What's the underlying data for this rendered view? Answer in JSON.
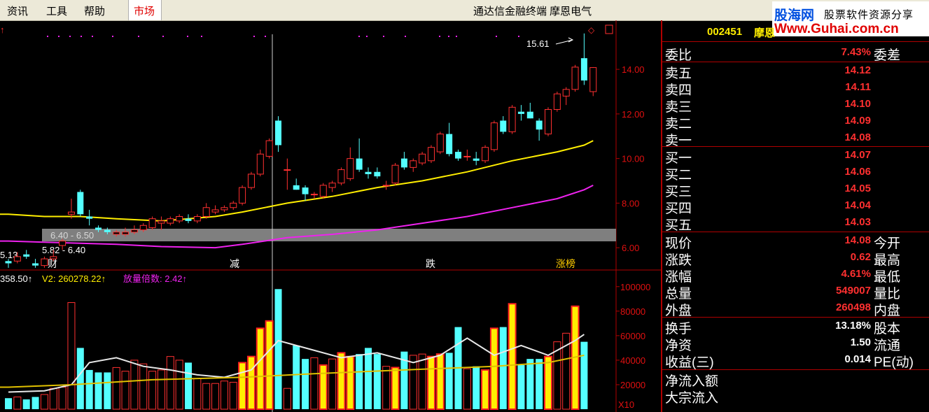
{
  "menu": {
    "items": [
      "资讯",
      "工具",
      "帮助"
    ],
    "market": "市场"
  },
  "window_title": "通达信金融终端  摩恩电气",
  "logo": {
    "brand": "股海网",
    "slogan": "股票软件资源分享",
    "url": "Www.Guhai.com.cn"
  },
  "stock": {
    "code": "002451",
    "name": "摩恩"
  },
  "kline": {
    "price_axis": [
      "14.00",
      "12.00",
      "10.00",
      "8.00",
      "6.00"
    ],
    "max_label": "15.61",
    "low_label": "5.13",
    "band_top_label": "6.40 - 6.50",
    "band_bottom_label": "5.82 - 6.40",
    "events": [
      "财",
      "减",
      "跌",
      "涨榜"
    ],
    "corner_marker": "↑"
  },
  "volume": {
    "v1": "358.50↑",
    "v2": "V2: 260278.22↑",
    "ratio": "放量倍数: 2.42↑",
    "axis": [
      "100000",
      "80000",
      "60000",
      "40000",
      "20000"
    ],
    "unit": "X10"
  },
  "quote": {
    "weibi": {
      "label": "委比",
      "value": "7.43%",
      "label2": "委差"
    },
    "sells": [
      {
        "label": "卖五",
        "price": "14.12"
      },
      {
        "label": "卖四",
        "price": "14.11"
      },
      {
        "label": "卖三",
        "price": "14.10"
      },
      {
        "label": "卖二",
        "price": "14.09"
      },
      {
        "label": "卖一",
        "price": "14.08"
      }
    ],
    "buys": [
      {
        "label": "买一",
        "price": "14.07"
      },
      {
        "label": "买二",
        "price": "14.06"
      },
      {
        "label": "买三",
        "price": "14.05"
      },
      {
        "label": "买四",
        "price": "14.04"
      },
      {
        "label": "买五",
        "price": "14.03"
      }
    ],
    "stats": [
      {
        "label": "现价",
        "value": "14.08",
        "label2": "今开"
      },
      {
        "label": "涨跌",
        "value": "0.62",
        "label2": "最高"
      },
      {
        "label": "涨幅",
        "value": "4.61%",
        "label2": "最低"
      },
      {
        "label": "总量",
        "value": "549007",
        "label2": "量比"
      },
      {
        "label": "外盘",
        "value": "260498",
        "label2": "内盘"
      }
    ],
    "extra": [
      {
        "label": "换手",
        "value": "13.18%",
        "label2": "股本"
      },
      {
        "label": "净资",
        "value": "1.50",
        "label2": "流通"
      },
      {
        "label": "收益(三)",
        "value": "0.014",
        "label2": "PE(动)"
      }
    ],
    "flows": [
      {
        "label": "净流入额"
      },
      {
        "label": "大宗流入"
      }
    ]
  },
  "colors": {
    "up": "#ff3030",
    "down": "#54ffff",
    "ma_short": "#ffee00",
    "ma_long": "#ee22ee",
    "axis": "#b00000"
  },
  "chart_data": {
    "type": "candlestick",
    "candles": [
      {
        "o": 5.4,
        "h": 5.5,
        "l": 5.1,
        "c": 5.3
      },
      {
        "o": 5.4,
        "h": 5.8,
        "l": 5.3,
        "c": 5.6
      },
      {
        "o": 5.7,
        "h": 5.9,
        "l": 5.5,
        "c": 5.6
      },
      {
        "o": 5.3,
        "h": 5.5,
        "l": 5.1,
        "c": 5.2
      },
      {
        "o": 5.2,
        "h": 5.6,
        "l": 5.1,
        "c": 5.5
      },
      {
        "o": 5.5,
        "h": 5.9,
        "l": 5.4,
        "c": 5.6
      },
      {
        "o": 6.1,
        "h": 6.4,
        "l": 5.9,
        "c": 6.3
      },
      {
        "o": 7.5,
        "h": 8.2,
        "l": 7.3,
        "c": 7.6
      },
      {
        "o": 8.5,
        "h": 8.6,
        "l": 7.4,
        "c": 7.5
      },
      {
        "o": 7.4,
        "h": 7.7,
        "l": 7.0,
        "c": 7.3
      },
      {
        "o": 6.9,
        "h": 7.0,
        "l": 6.7,
        "c": 6.8
      },
      {
        "o": 6.8,
        "h": 6.9,
        "l": 6.6,
        "c": 6.7
      },
      {
        "o": 6.6,
        "h": 6.8,
        "l": 6.5,
        "c": 6.7
      },
      {
        "o": 6.6,
        "h": 6.9,
        "l": 6.5,
        "c": 6.7
      },
      {
        "o": 6.7,
        "h": 7.0,
        "l": 6.6,
        "c": 6.8
      },
      {
        "o": 6.8,
        "h": 7.1,
        "l": 6.7,
        "c": 7.0
      },
      {
        "o": 6.9,
        "h": 7.4,
        "l": 6.8,
        "c": 7.3
      },
      {
        "o": 7.1,
        "h": 7.4,
        "l": 6.8,
        "c": 7.2
      },
      {
        "o": 7.1,
        "h": 7.4,
        "l": 7.0,
        "c": 7.3
      },
      {
        "o": 7.2,
        "h": 7.5,
        "l": 7.1,
        "c": 7.4
      },
      {
        "o": 7.3,
        "h": 7.5,
        "l": 7.1,
        "c": 7.2
      },
      {
        "o": 7.2,
        "h": 7.5,
        "l": 7.1,
        "c": 7.4
      },
      {
        "o": 7.4,
        "h": 8.0,
        "l": 7.3,
        "c": 7.8
      },
      {
        "o": 7.6,
        "h": 7.9,
        "l": 7.5,
        "c": 7.7
      },
      {
        "o": 7.7,
        "h": 7.9,
        "l": 7.6,
        "c": 7.8
      },
      {
        "o": 7.8,
        "h": 8.1,
        "l": 7.7,
        "c": 8.0
      },
      {
        "o": 8.0,
        "h": 8.8,
        "l": 7.9,
        "c": 8.7
      },
      {
        "o": 8.7,
        "h": 9.4,
        "l": 8.6,
        "c": 9.3
      },
      {
        "o": 9.3,
        "h": 10.4,
        "l": 9.2,
        "c": 10.2
      },
      {
        "o": 10.1,
        "h": 10.9,
        "l": 10.0,
        "c": 10.8
      },
      {
        "o": 11.7,
        "h": 11.9,
        "l": 10.3,
        "c": 10.6
      },
      {
        "o": 9.5,
        "h": 10.0,
        "l": 8.6,
        "c": 9.5
      },
      {
        "o": 8.8,
        "h": 9.1,
        "l": 8.6,
        "c": 8.6
      },
      {
        "o": 8.7,
        "h": 8.8,
        "l": 8.1,
        "c": 8.4
      },
      {
        "o": 8.4,
        "h": 8.5,
        "l": 8.2,
        "c": 8.4
      },
      {
        "o": 8.3,
        "h": 8.9,
        "l": 8.2,
        "c": 8.8
      },
      {
        "o": 8.7,
        "h": 9.0,
        "l": 8.5,
        "c": 8.9
      },
      {
        "o": 8.9,
        "h": 9.6,
        "l": 8.8,
        "c": 9.5
      },
      {
        "o": 9.1,
        "h": 10.5,
        "l": 9.0,
        "c": 10.0
      },
      {
        "o": 10.0,
        "h": 10.9,
        "l": 9.4,
        "c": 9.5
      },
      {
        "o": 9.4,
        "h": 9.6,
        "l": 9.1,
        "c": 9.3
      },
      {
        "o": 9.4,
        "h": 9.6,
        "l": 9.1,
        "c": 9.2
      },
      {
        "o": 8.8,
        "h": 9.0,
        "l": 8.6,
        "c": 8.8
      },
      {
        "o": 8.9,
        "h": 9.8,
        "l": 8.8,
        "c": 9.7
      },
      {
        "o": 10.0,
        "h": 10.3,
        "l": 9.5,
        "c": 9.6
      },
      {
        "o": 9.6,
        "h": 10.0,
        "l": 9.4,
        "c": 9.9
      },
      {
        "o": 9.8,
        "h": 10.3,
        "l": 9.7,
        "c": 10.2
      },
      {
        "o": 9.9,
        "h": 10.6,
        "l": 9.8,
        "c": 10.5
      },
      {
        "o": 10.3,
        "h": 11.2,
        "l": 10.2,
        "c": 11.1
      },
      {
        "o": 11.1,
        "h": 11.6,
        "l": 10.1,
        "c": 10.2
      },
      {
        "o": 10.3,
        "h": 10.4,
        "l": 9.9,
        "c": 10.0
      },
      {
        "o": 10.1,
        "h": 10.4,
        "l": 9.9,
        "c": 10.1
      },
      {
        "o": 10.0,
        "h": 10.3,
        "l": 9.7,
        "c": 9.9
      },
      {
        "o": 9.9,
        "h": 10.6,
        "l": 9.8,
        "c": 10.5
      },
      {
        "o": 10.4,
        "h": 11.7,
        "l": 10.3,
        "c": 11.6
      },
      {
        "o": 11.7,
        "h": 11.9,
        "l": 11.1,
        "c": 11.2
      },
      {
        "o": 11.2,
        "h": 12.4,
        "l": 11.1,
        "c": 12.3
      },
      {
        "o": 12.1,
        "h": 12.4,
        "l": 11.7,
        "c": 12.0
      },
      {
        "o": 12.1,
        "h": 12.5,
        "l": 11.8,
        "c": 11.8
      },
      {
        "o": 11.7,
        "h": 11.8,
        "l": 10.8,
        "c": 11.3
      },
      {
        "o": 11.1,
        "h": 12.3,
        "l": 11.0,
        "c": 12.2
      },
      {
        "o": 12.2,
        "h": 13.0,
        "l": 12.1,
        "c": 12.9
      },
      {
        "o": 12.8,
        "h": 13.2,
        "l": 12.4,
        "c": 13.1
      },
      {
        "o": 13.1,
        "h": 14.2,
        "l": 13.0,
        "c": 14.1
      },
      {
        "o": 14.5,
        "h": 15.61,
        "l": 13.3,
        "c": 13.5
      },
      {
        "o": 13.0,
        "h": 14.1,
        "l": 12.8,
        "c": 14.08
      }
    ],
    "volumes": [
      9000,
      10000,
      8000,
      10000,
      12000,
      17000,
      18000,
      87000,
      50000,
      32000,
      30000,
      30000,
      34000,
      31000,
      40000,
      37000,
      31000,
      32000,
      43000,
      40000,
      38000,
      25000,
      21000,
      21000,
      23000,
      22000,
      38000,
      43000,
      66000,
      72000,
      98000,
      17000,
      52000,
      41000,
      42000,
      36000,
      41000,
      46000,
      43000,
      45000,
      50000,
      45000,
      35000,
      34000,
      47000,
      44000,
      45000,
      43000,
      45000,
      46000,
      67000,
      33000,
      35000,
      32000,
      66000,
      67000,
      86000,
      36000,
      41000,
      41000,
      43000,
      55000,
      62000,
      84000,
      55000
    ],
    "ma_short": [
      [
        0,
        7.5
      ],
      [
        4,
        7.4
      ],
      [
        8,
        7.4
      ],
      [
        12,
        7.3
      ],
      [
        17,
        7.2
      ],
      [
        23,
        7.4
      ],
      [
        26,
        7.6
      ],
      [
        31,
        8.0
      ],
      [
        36,
        8.3
      ],
      [
        41,
        8.7
      ],
      [
        46,
        9.0
      ],
      [
        51,
        9.4
      ],
      [
        56,
        9.9
      ],
      [
        61,
        10.3
      ],
      [
        64,
        10.6
      ],
      [
        65,
        10.8
      ]
    ],
    "ma_long": [
      [
        0,
        6.3
      ],
      [
        4,
        6.25
      ],
      [
        8,
        6.2
      ],
      [
        12,
        6.15
      ],
      [
        17,
        6.05
      ],
      [
        23,
        6.0
      ],
      [
        26,
        6.15
      ],
      [
        31,
        6.45
      ],
      [
        36,
        6.6
      ],
      [
        41,
        6.8
      ],
      [
        46,
        7.1
      ],
      [
        51,
        7.4
      ],
      [
        56,
        7.8
      ],
      [
        61,
        8.2
      ],
      [
        64,
        8.6
      ],
      [
        65,
        8.8
      ]
    ],
    "vol_ma_white": [
      [
        0,
        14000
      ],
      [
        4,
        15000
      ],
      [
        7,
        20000
      ],
      [
        9,
        38000
      ],
      [
        12,
        42000
      ],
      [
        15,
        35000
      ],
      [
        18,
        32000
      ],
      [
        21,
        28000
      ],
      [
        24,
        26000
      ],
      [
        27,
        32000
      ],
      [
        30,
        56000
      ],
      [
        33,
        50000
      ],
      [
        37,
        42000
      ],
      [
        41,
        46000
      ],
      [
        45,
        38000
      ],
      [
        48,
        44000
      ],
      [
        51,
        58000
      ],
      [
        54,
        44000
      ],
      [
        57,
        52000
      ],
      [
        60,
        44000
      ],
      [
        63,
        56000
      ],
      [
        64,
        61000
      ]
    ],
    "vol_ma_yellow": [
      [
        0,
        18000
      ],
      [
        7,
        20000
      ],
      [
        16,
        24000
      ],
      [
        26,
        26000
      ],
      [
        34,
        29000
      ],
      [
        44,
        32000
      ],
      [
        54,
        35000
      ],
      [
        60,
        38000
      ],
      [
        64,
        44000
      ]
    ],
    "ylim_price": [
      5.0,
      16.2
    ],
    "ylim_volume": [
      0,
      105000
    ]
  }
}
